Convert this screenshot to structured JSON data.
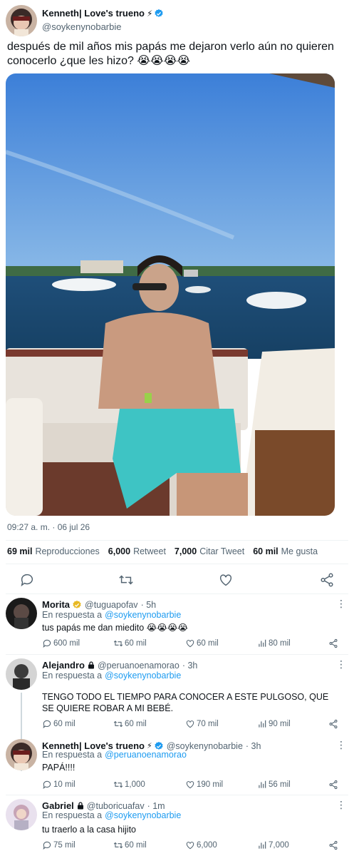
{
  "main": {
    "author_name": "Kenneth| Love's trueno",
    "author_emoji": "⚡",
    "author_handle": "@soykenynobarbie",
    "text": "después de mil años mis papás me dejaron verlo aún no quieren conocerlo ¿que les hizo? 😭😭😭😭",
    "timestamp": "09:27 a. m. · 06 jul 26",
    "stats": [
      {
        "value": "69 mil",
        "label": "Reproducciones"
      },
      {
        "value": "6,000",
        "label": "Retweet"
      },
      {
        "value": "7,000",
        "label": "Citar Tweet"
      },
      {
        "value": "60 mil",
        "label": "Me gusta"
      }
    ]
  },
  "reply_prefix": "En respuesta a",
  "replies": [
    {
      "name": "Morita",
      "emoji": "",
      "handle": "@tuguapofav",
      "time": "· 5h",
      "reply_to": "@soykenynobarbie",
      "text": "tus papás me dan miedito 😭😭😭😭",
      "replies": "600 mil",
      "retweets": "60 mil",
      "likes": "60 mil",
      "views": "80 mil"
    },
    {
      "name": "Alejandro",
      "emoji": "",
      "handle": "@peruanoenamorao",
      "time": "· 3h",
      "reply_to": "@soykenynobarbie",
      "text": "TENGO TODO EL TIEMPO PARA CONOCER A ESTE PULGOSO, QUE SE QUIERE ROBAR A MI BEBÉ.",
      "replies": "60 mil",
      "retweets": "60 mil",
      "likes": "70 mil",
      "views": "90 mil"
    },
    {
      "name": "Kenneth| Love's trueno",
      "emoji": "⚡",
      "handle": "@soykenynobarbie",
      "time": "· 3h",
      "reply_to": "@peruanoenamorao",
      "text": "PAPÁ!!!!",
      "replies": "10 mil",
      "retweets": "1,000",
      "likes": "190 mil",
      "views": "56 mil"
    },
    {
      "name": "Gabriel",
      "emoji": "",
      "handle": "@tuboricuafav",
      "time": "· 1m",
      "reply_to": "@soykenynobarbie",
      "text": "tu traerlo a la casa hijito",
      "replies": "75 mil",
      "retweets": "60 mil",
      "likes": "6,000",
      "views": "7,000"
    }
  ],
  "colors": {
    "accent": "#1d9bf0",
    "verified_gold": "#e8b923",
    "text": "#0f1419",
    "muted": "#536471"
  },
  "icons": [
    "verified-icon",
    "lock-icon",
    "reply-icon",
    "retweet-icon",
    "like-icon",
    "share-icon",
    "views-icon",
    "more-icon"
  ]
}
